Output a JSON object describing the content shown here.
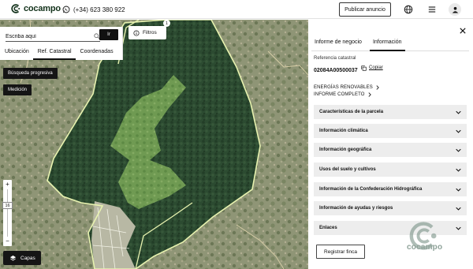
{
  "header": {
    "brand": "cocampo",
    "phone": "(+34) 623 380 922",
    "publish_label": "Publicar anuncio"
  },
  "map": {
    "search": {
      "placeholder": "Escriba aquí",
      "go_label": "Ir"
    },
    "search_tabs": [
      {
        "label": "Ubicación",
        "active": false
      },
      {
        "label": "Ref. Catastral",
        "active": true
      },
      {
        "label": "Coordenadas",
        "active": false
      }
    ],
    "filters_label": "Filtros",
    "filters_count": "1",
    "progressive_search_label": "Búsqueda progresiva",
    "measure_label": "Medición",
    "zoom": {
      "plus": "+",
      "minus": "−",
      "level": "16"
    },
    "layers_label": "Capas"
  },
  "panel": {
    "tabs": [
      {
        "label": "Informe de negocio",
        "active": false
      },
      {
        "label": "Información",
        "active": true
      }
    ],
    "cadastral_ref_label": "Referencia catastral",
    "cadastral_ref_value": "02084A00500037",
    "copy_label": "Copiar",
    "links": [
      "ENERGÍAS RENOVABLES",
      "INFORME COMPLETO"
    ],
    "sections": [
      "Características de la parcela",
      "Información climática",
      "Información geográfica",
      "Usos del suelo y cultivos",
      "Información de la Confederación Hidrográfica",
      "Información de ayudas y riesgos",
      "Enlaces"
    ],
    "register_label": "Registrar finca",
    "watermark_text": "cocampo"
  },
  "colors": {
    "brand_dark": "#14331c",
    "forest_dark": "#2a4a30",
    "forest_light": "#6f9b52",
    "parcel_outline": "#e8f3b0",
    "accordion_bg": "#ededed"
  }
}
